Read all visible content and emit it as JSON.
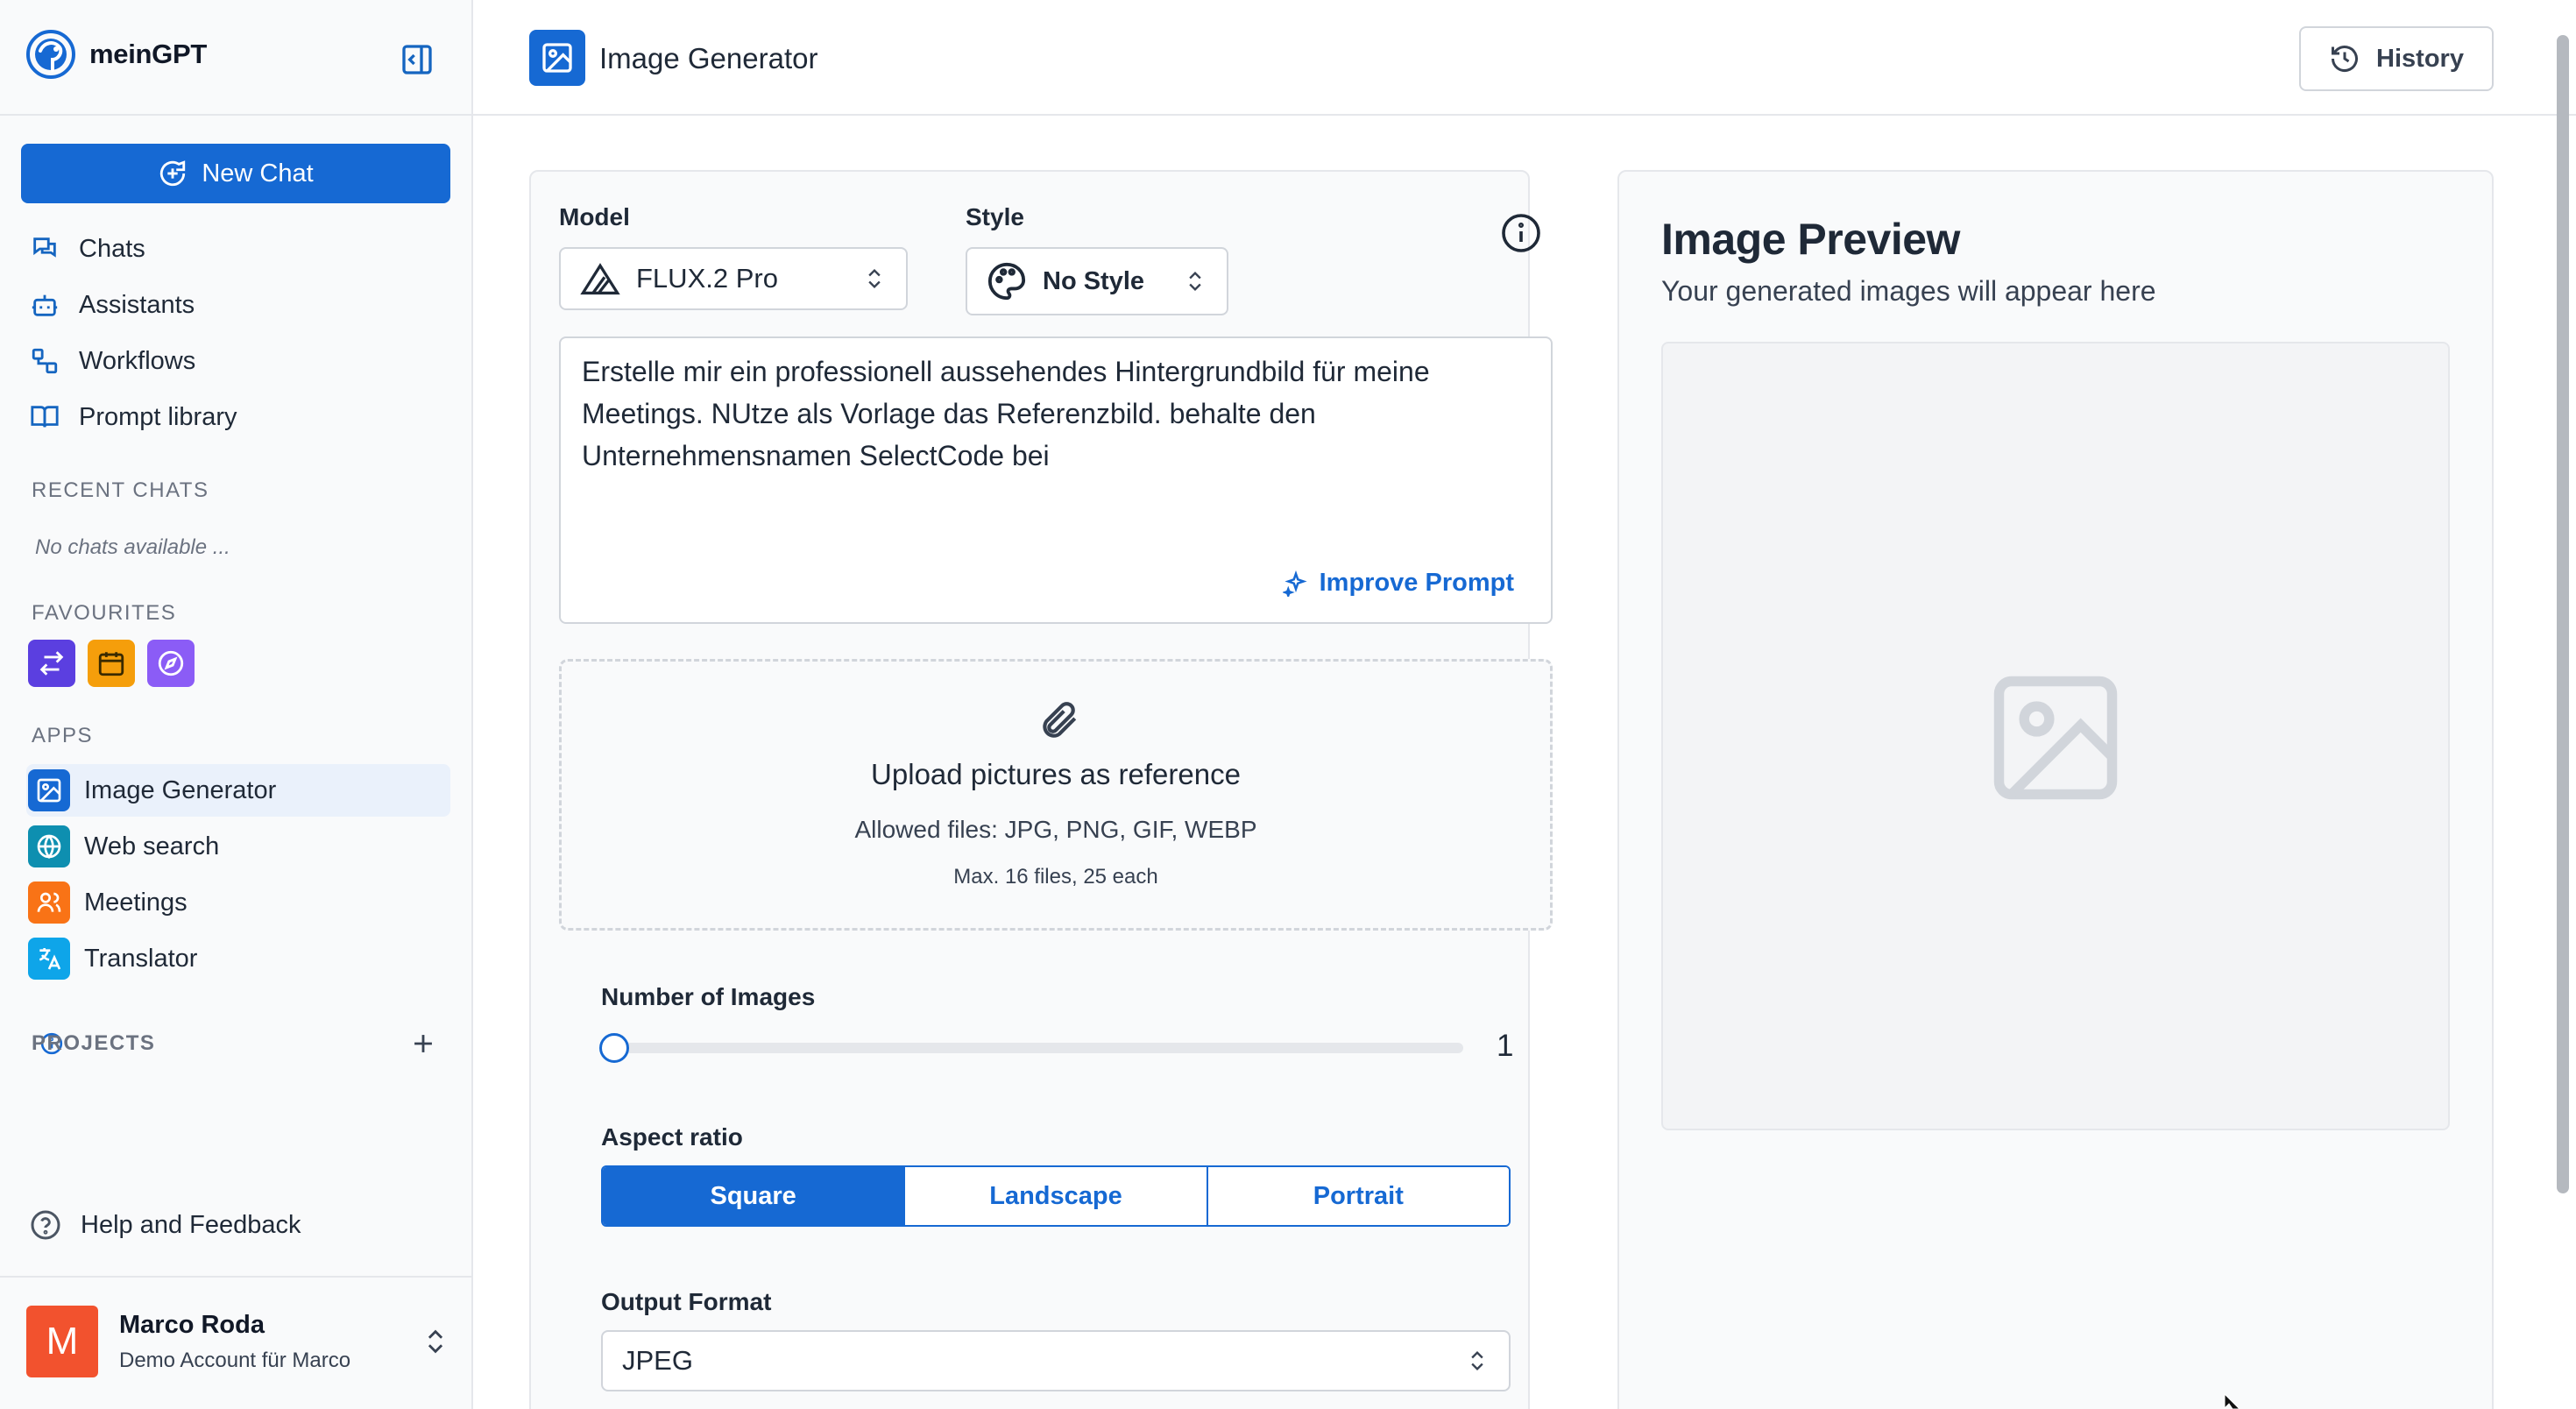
{
  "brand": {
    "name": "meinGPT"
  },
  "sidebar": {
    "new_chat": "New Chat",
    "nav": [
      {
        "label": "Chats",
        "icon": "chats-icon"
      },
      {
        "label": "Assistants",
        "icon": "bot-icon"
      },
      {
        "label": "Workflows",
        "icon": "workflow-icon"
      },
      {
        "label": "Prompt library",
        "icon": "book-icon"
      }
    ],
    "recent_label": "RECENT CHATS",
    "no_chats": "No chats available ...",
    "favourites_label": "FAVOURITES",
    "favourites": [
      {
        "icon": "swap-arrows-icon",
        "color": "#5b3fe0"
      },
      {
        "icon": "calendar-icon",
        "color": "#f59e0b"
      },
      {
        "icon": "compass-icon",
        "color": "#8b5cf6"
      }
    ],
    "apps_label": "APPS",
    "apps": [
      {
        "label": "Image Generator",
        "icon": "image-icon",
        "color": "#1669d3",
        "active": true
      },
      {
        "label": "Web search",
        "icon": "globe-icon",
        "color": "#0e8fb0"
      },
      {
        "label": "Meetings",
        "icon": "users-icon",
        "color": "#f97316"
      },
      {
        "label": "Translator",
        "icon": "translate-icon",
        "color": "#0ea5e9"
      }
    ],
    "projects_label": "PROJECTS",
    "help": "Help and Feedback",
    "user": {
      "initial": "M",
      "name": "Marco Roda",
      "account": "Demo Account für Marco"
    }
  },
  "header": {
    "title": "Image Generator",
    "history": "History"
  },
  "form": {
    "model_label": "Model",
    "model_value": "FLUX.2 Pro",
    "style_label": "Style",
    "style_value": "No Style",
    "prompt": "Erstelle mir ein professionell aussehendes Hintergrundbild für meine Meetings. NUtze als Vorlage das Referenzbild. behalte den Unternehmensnamen SelectCode bei",
    "improve": "Improve Prompt",
    "upload": {
      "title": "Upload pictures as reference",
      "allowed": "Allowed files: JPG, PNG, GIF, WEBP",
      "max": "Max. 16 files, 25 each"
    },
    "num_images_label": "Number of Images",
    "num_images_value": "1",
    "aspect_label": "Aspect ratio",
    "aspect_options": [
      "Square",
      "Landscape",
      "Portrait"
    ],
    "aspect_selected": "Square",
    "output_label": "Output Format",
    "output_value": "JPEG"
  },
  "preview": {
    "title": "Image Preview",
    "subtitle": "Your generated images will appear here"
  },
  "colors": {
    "accent": "#1669d3",
    "avatar": "#f2522e"
  }
}
